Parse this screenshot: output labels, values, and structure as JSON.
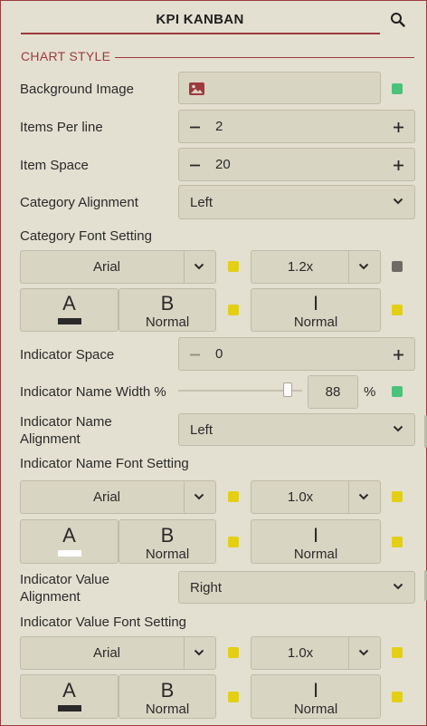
{
  "header": {
    "title": "KPI KANBAN"
  },
  "section": {
    "title": "CHART STYLE"
  },
  "rows": {
    "background_image": {
      "label": "Background Image"
    },
    "items_per_line": {
      "label": "Items Per line",
      "value": "2"
    },
    "item_space": {
      "label": "Item Space",
      "value": "20"
    },
    "category_alignment": {
      "label": "Category Alignment",
      "value": "Left"
    },
    "category_font": {
      "label": "Category Font Setting"
    },
    "indicator_space": {
      "label": "Indicator Space",
      "value": "0"
    },
    "indicator_name_width": {
      "label": "Indicator Name Width %",
      "value": "88",
      "unit": "%",
      "fraction": 0.88
    },
    "indicator_name_alignment": {
      "label_line1": "Indicator Name",
      "label_line2": "Alignment",
      "value": "Left"
    },
    "indicator_name_font": {
      "label": "Indicator Name Font Setting"
    },
    "indicator_value_alignment": {
      "label_line1": "Indicator Value",
      "label_line2": "Alignment",
      "value": "Right"
    },
    "indicator_value_font": {
      "label": "Indicator Value Font Setting"
    }
  },
  "font_groups": {
    "category": {
      "family": "Arial",
      "size": "1.2x",
      "color_glyph": "A",
      "color_bar": "#2a2a2a",
      "weight_glyph": "B",
      "weight": "Normal",
      "style_glyph": "I",
      "style": "Normal",
      "size_swatch": "#6e6a66"
    },
    "indicator_name": {
      "family": "Arial",
      "size": "1.0x",
      "color_glyph": "A",
      "color_bar": "#ffffff",
      "weight_glyph": "B",
      "weight": "Normal",
      "style_glyph": "I",
      "style": "Normal",
      "size_swatch": "#e3cf14"
    },
    "indicator_value": {
      "family": "Arial",
      "size": "1.0x",
      "color_glyph": "A",
      "color_bar": "#2a2a2a",
      "weight_glyph": "B",
      "weight": "Normal",
      "style_glyph": "I",
      "style": "Normal",
      "size_swatch": "#e3cf14"
    }
  },
  "colors": {
    "accent": "#9d3a3e",
    "toggle_on": "#4bc27a",
    "toggle_yellow": "#e3cf14",
    "toggle_gray": "#6e6a66",
    "panel_bg": "#e3e0d1",
    "field_bg": "#d9d5c3"
  },
  "icons": {
    "search": "search-icon",
    "image": "image-icon",
    "minus": "minus-icon",
    "plus": "plus-icon",
    "chevron": "chevron-down-icon"
  }
}
